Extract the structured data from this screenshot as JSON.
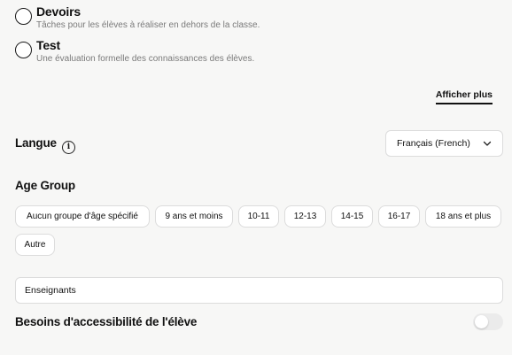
{
  "options": [
    {
      "title": "Devoirs",
      "description": "Tâches pour les élèves à réaliser en dehors de la classe."
    },
    {
      "title": "Test",
      "description": "Une évaluation formelle des connaissances des élèves."
    }
  ],
  "show_more_label": "Afficher plus",
  "language": {
    "label": "Langue",
    "info_icon": "info-icon",
    "selected": "Français (French)",
    "chevron_icon": "chevron-down-icon"
  },
  "age_group": {
    "label": "Age Group",
    "chips": [
      "Aucun groupe d'âge spécifié",
      "9 ans et moins",
      "10-11",
      "12-13",
      "14-15",
      "16-17",
      "18 ans et plus",
      "Autre"
    ]
  },
  "audience_field": {
    "value": "Enseignants"
  },
  "accessibility": {
    "label": "Besoins d'accessibilité de l'élève",
    "enabled": false
  }
}
